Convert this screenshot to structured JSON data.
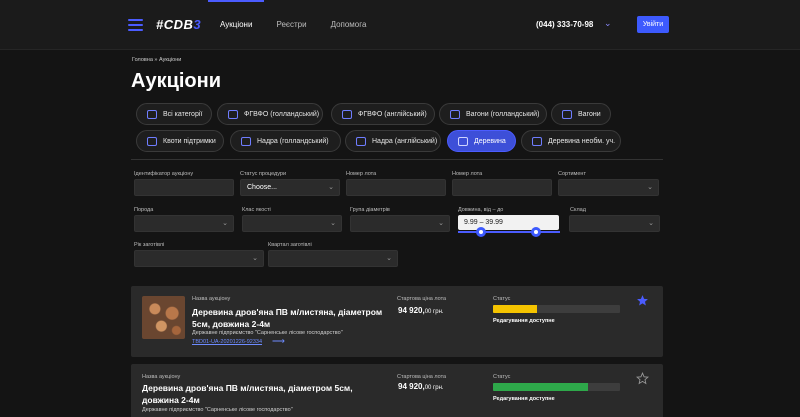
{
  "header": {
    "logo_prefix": "#CDB",
    "logo_suffix": "3",
    "nav": [
      "Аукціони",
      "Реєстри",
      "Допомога"
    ],
    "phone": "(044) 333-70-98",
    "login": "Увійти"
  },
  "breadcrumb": "Головна » Аукціони",
  "title": "Аукціони",
  "categories": [
    "Всі категорії",
    "ФГВФО (голландський)",
    "ФГВФО (англійський)",
    "Вагони (голландський)",
    "Вагони",
    "Квоти підтримки",
    "Надра (голландський)",
    "Надра (англійський)",
    "Деревина",
    "Деревина необм. уч."
  ],
  "active_category": "Деревина",
  "filters": {
    "auction_id": {
      "label": "Ідентифікатор аукціону",
      "value": ""
    },
    "status": {
      "label": "Статус процедури",
      "value": "Choose..."
    },
    "lot_number": {
      "label": "Номер лота",
      "value": ""
    },
    "lot_number_2": {
      "label": "Номер лота",
      "value": ""
    },
    "assortment": {
      "label": "Сортимент",
      "value": ""
    },
    "species": {
      "label": "Порода",
      "value": ""
    },
    "quality": {
      "label": "Клас якості",
      "value": ""
    },
    "diameter": {
      "label": "Група діаметрів",
      "value": ""
    },
    "length": {
      "label": "Довжина, від – до",
      "value": "9.99 – 39.99",
      "min": 9.99,
      "max": 39.99
    },
    "warehouse": {
      "label": "Склад",
      "value": ""
    },
    "year": {
      "label": "Рік заготівлі",
      "value": ""
    },
    "quarter": {
      "label": "Квартал заготівлі",
      "value": ""
    }
  },
  "lots": [
    {
      "name_label": "Назва аукціону",
      "title": "Деревина дров'яна ПВ м/листяна, діаметром 5см, довжина 2-4м",
      "org": "Державне підприємство \"Сарненське лісове господарство\"",
      "id": "TBD01-UA-20201226-92334",
      "price_label": "Стартова ціна лота",
      "price_int": "94 920,",
      "price_dec": "00 грн.",
      "status_label": "Статус",
      "status_text": "Редагування доступне",
      "progress": 0.35,
      "progress_color": "#f5c400",
      "favorite": true
    },
    {
      "name_label": "Назва аукціону",
      "title": "Деревина дров'яна ПВ м/листяна, діаметром 5см, довжина 2-4м",
      "org": "Державне підприємство \"Сарненське лісове господарство\"",
      "price_label": "Стартова ціна лота",
      "price_int": "94 920,",
      "price_dec": "00 грн.",
      "status_label": "Статус",
      "status_text": "Редагування доступне",
      "progress": 0.75,
      "progress_color": "#2ea84a",
      "favorite": false
    }
  ],
  "colors": {
    "accent": "#3d5afe",
    "background": "#141414",
    "card": "#2a2a2a"
  }
}
